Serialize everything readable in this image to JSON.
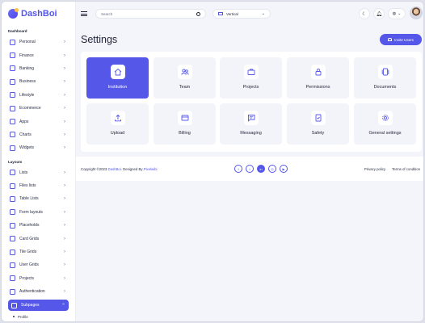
{
  "brand": {
    "name": "DashBoi"
  },
  "sidebar": {
    "dashboard_title": "Dashboard",
    "dashboard_items": [
      {
        "label": "Personal"
      },
      {
        "label": "Finance"
      },
      {
        "label": "Banking"
      },
      {
        "label": "Business"
      },
      {
        "label": "Lifestyle"
      },
      {
        "label": "Ecommerce"
      },
      {
        "label": "Apps"
      },
      {
        "label": "Charts"
      },
      {
        "label": "Widgets"
      }
    ],
    "layouts_title": "Layouts",
    "layout_items": [
      {
        "label": "Lists"
      },
      {
        "label": "Files lists"
      },
      {
        "label": "Table Lists"
      },
      {
        "label": "Form layouts"
      },
      {
        "label": "Placeholds"
      },
      {
        "label": "Card Grids"
      },
      {
        "label": "Tile Grids"
      },
      {
        "label": "User Grids"
      },
      {
        "label": "Projects"
      },
      {
        "label": "Authentication"
      }
    ],
    "active_item": {
      "label": "Subpages"
    },
    "sub_items": [
      {
        "label": "Profile"
      }
    ]
  },
  "header": {
    "search_placeholder": "Search",
    "layout_select_value": "Vertical"
  },
  "page": {
    "title": "Settings",
    "invite_label": "Invite Users"
  },
  "tiles": [
    {
      "label": "Institution",
      "icon": "home-icon"
    },
    {
      "label": "Team",
      "icon": "team-icon"
    },
    {
      "label": "Projects",
      "icon": "briefcase-icon"
    },
    {
      "label": "Permissions",
      "icon": "lock-icon"
    },
    {
      "label": "Documents",
      "icon": "documents-icon"
    },
    {
      "label": "Upload",
      "icon": "upload-icon"
    },
    {
      "label": "Billing",
      "icon": "credit-card-icon"
    },
    {
      "label": "Messaging",
      "icon": "message-icon"
    },
    {
      "label": "Safety",
      "icon": "shield-check-icon"
    },
    {
      "label": "General settings",
      "icon": "gear-icon"
    }
  ],
  "footer": {
    "copyright_prefix": "Copyright ©2023",
    "copyright_brand": "DashBoi",
    "designed_by": ". Designed By",
    "designer": "Pixelwibi",
    "privacy": "Privacy policy",
    "terms": "Terms of condition"
  },
  "colors": {
    "accent": "#5457e8",
    "background": "#f4f5fb"
  }
}
